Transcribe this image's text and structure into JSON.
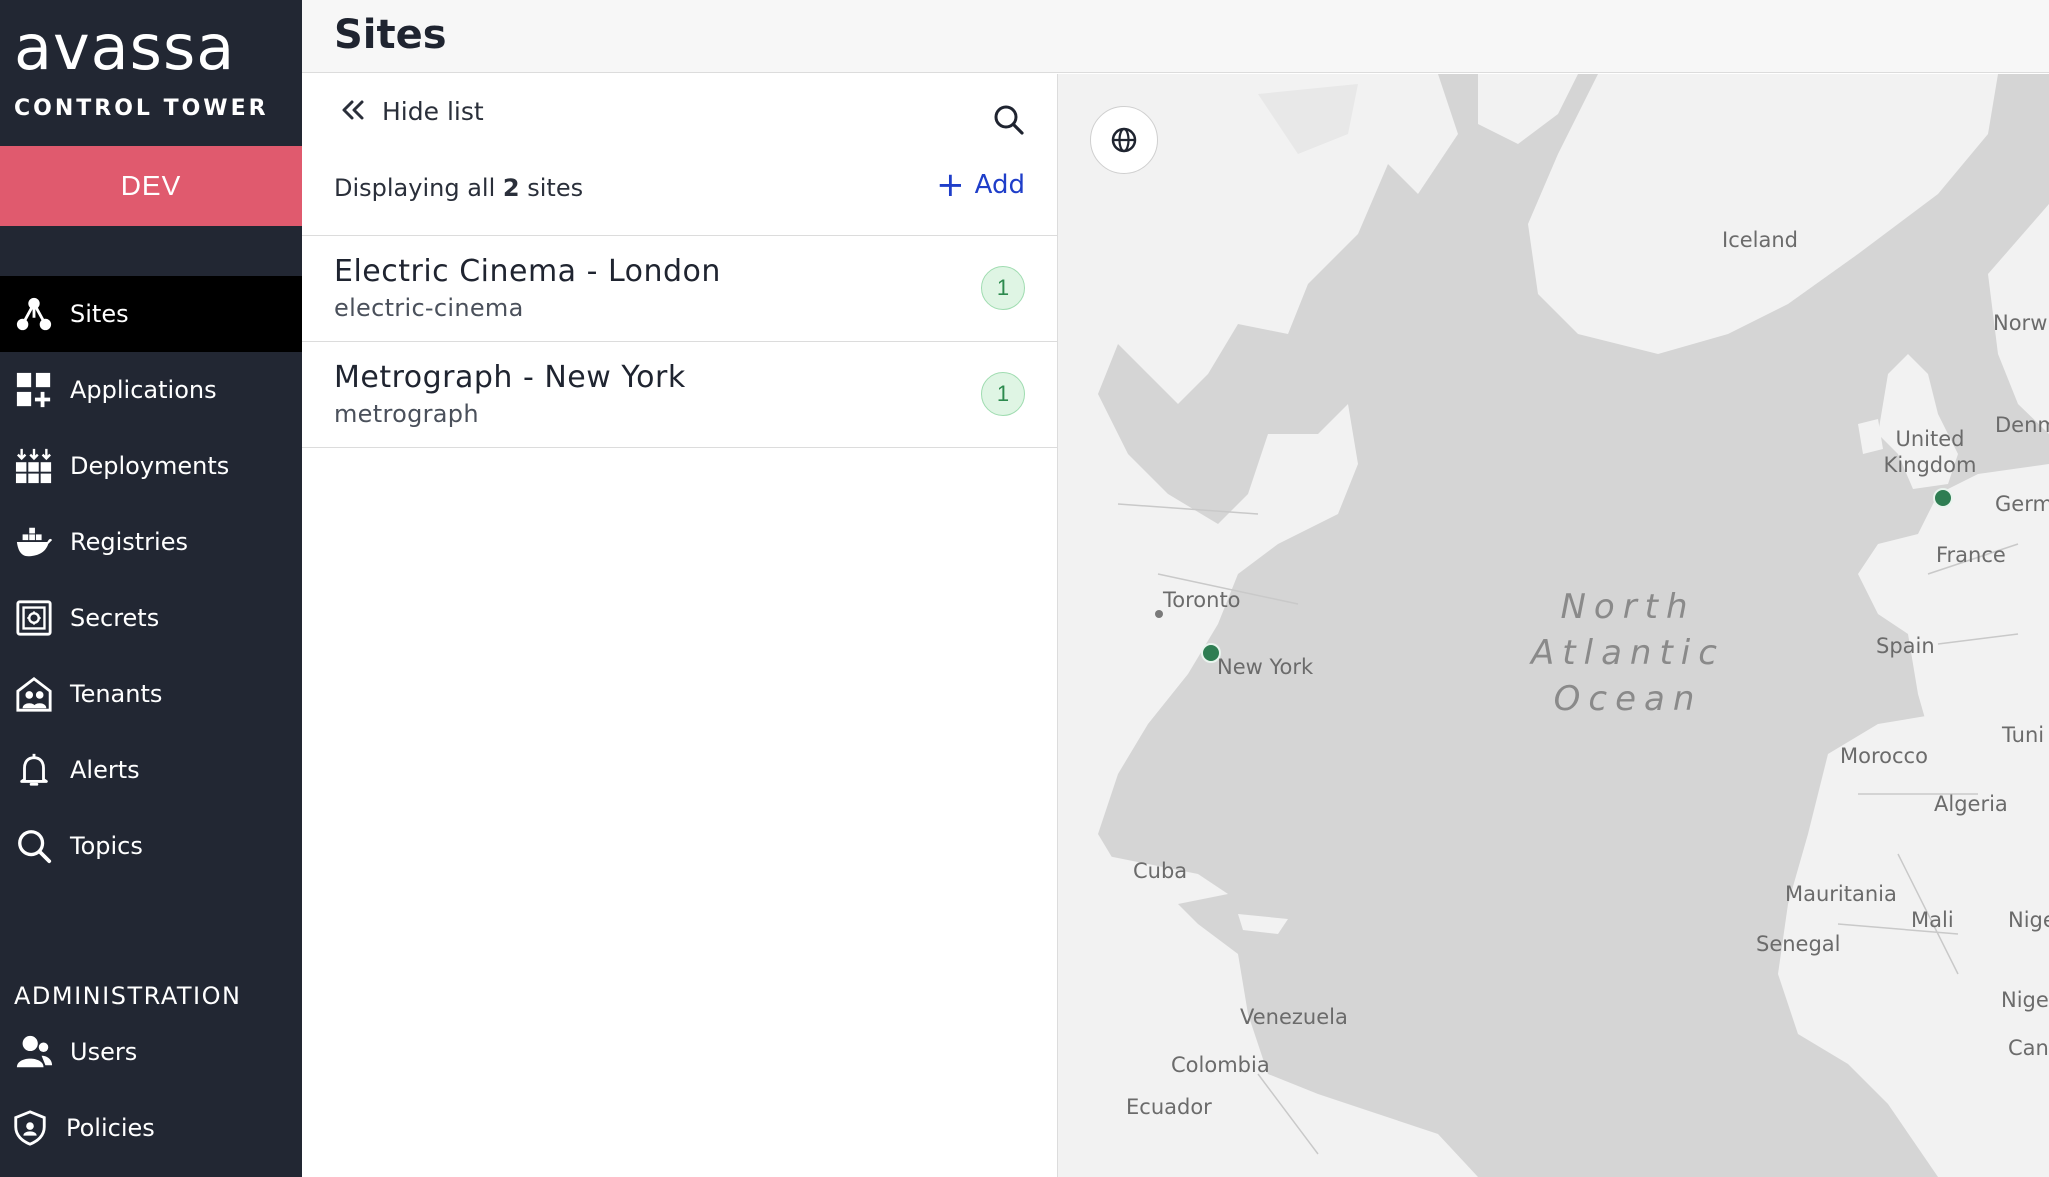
{
  "brand": {
    "name": "avassa",
    "product": "CONTROL TOWER"
  },
  "environment": "DEV",
  "nav": {
    "items": [
      {
        "label": "Sites",
        "icon": "sites-icon"
      },
      {
        "label": "Applications",
        "icon": "applications-icon"
      },
      {
        "label": "Deployments",
        "icon": "deployments-icon"
      },
      {
        "label": "Registries",
        "icon": "registries-icon"
      },
      {
        "label": "Secrets",
        "icon": "secrets-icon"
      },
      {
        "label": "Tenants",
        "icon": "tenants-icon"
      },
      {
        "label": "Alerts",
        "icon": "bell-icon"
      },
      {
        "label": "Topics",
        "icon": "search-icon"
      }
    ],
    "admin_heading": "ADMINISTRATION",
    "admin_items": [
      {
        "label": "Users",
        "icon": "users-icon"
      },
      {
        "label": "Policies",
        "icon": "shield-icon"
      }
    ]
  },
  "header": {
    "title": "Sites"
  },
  "list": {
    "hide_label": "Hide list",
    "count_prefix": "Displaying all",
    "count_value": "2",
    "count_suffix": "sites",
    "add_label": "Add",
    "sites": [
      {
        "name": "Electric Cinema - London",
        "id": "electric-cinema",
        "count": "1"
      },
      {
        "name": "Metrograph - New York",
        "id": "metrograph",
        "count": "1"
      }
    ]
  },
  "map": {
    "ocean": [
      "North",
      "Atlantic",
      "Ocean"
    ],
    "labels": {
      "iceland": "Iceland",
      "norway": "Norw",
      "denmark": "Denm",
      "uk": "United Kingdom",
      "germany": "Germ",
      "france": "France",
      "spain": "Spain",
      "tunisia": "Tuni",
      "morocco": "Morocco",
      "algeria": "Algeria",
      "mauritania": "Mauritania",
      "mali": "Mali",
      "niger": "Nige",
      "senegal": "Senegal",
      "nigeria": "Nigeri",
      "cameroon": "Can",
      "toronto": "Toronto",
      "newyork": "New York",
      "cuba": "Cuba",
      "venezuela": "Venezuela",
      "colombia": "Colombia",
      "ecuador": "Ecuador"
    }
  },
  "colors": {
    "sidebar": "#222733",
    "env_badge": "#e05a6e",
    "accent": "#1f3ec9",
    "site_marker": "#2e7d52",
    "land": "#f2f2f2",
    "water": "#d5d5d5"
  }
}
